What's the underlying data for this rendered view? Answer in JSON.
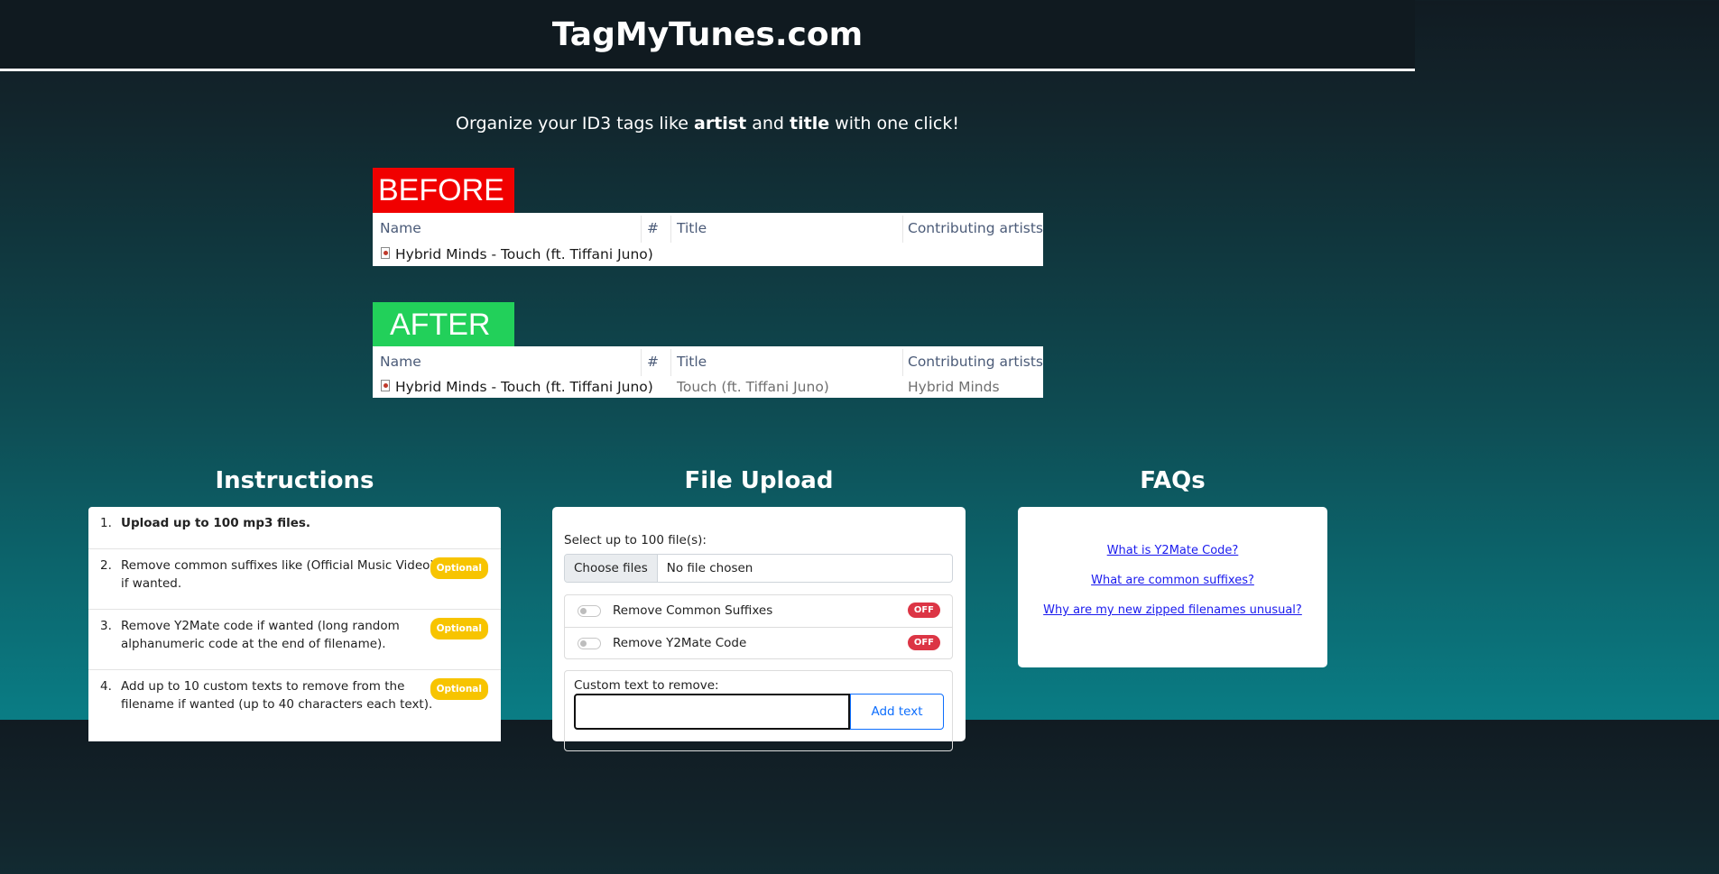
{
  "header": {
    "title": "TagMyTunes.com"
  },
  "tagline": {
    "before": "Organize your ID3 tags like ",
    "artist": "artist",
    "mid": " and ",
    "title": "title",
    "after": " with one click!"
  },
  "before": {
    "badge": "BEFORE",
    "columns": [
      "Name",
      "#",
      "Title",
      "Contributing artists"
    ],
    "row": {
      "name": "Hybrid Minds - Touch (ft. Tiffani Juno)",
      "number": "",
      "title": "",
      "artists": ""
    }
  },
  "after": {
    "badge": "AFTER",
    "columns": [
      "Name",
      "#",
      "Title",
      "Contributing artists"
    ],
    "row": {
      "name": "Hybrid Minds - Touch (ft. Tiffani Juno)",
      "number": "",
      "title": "Touch (ft. Tiffani Juno)",
      "artists": "Hybrid Minds"
    }
  },
  "instructions": {
    "heading": "Instructions",
    "items": [
      {
        "num": "1.",
        "text": "Upload up to 100 mp3 files.",
        "badge": ""
      },
      {
        "num": "2.",
        "text": "Remove common suffixes like (Official Music Video) if wanted.",
        "badge": "Optional"
      },
      {
        "num": "3.",
        "text": "Remove Y2Mate code if wanted (long random alphanumeric code at the end of filename).",
        "badge": "Optional"
      },
      {
        "num": "4.",
        "text": "Add up to 10 custom texts to remove from the filename if wanted (up to 40 characters each text).",
        "badge": "Optional"
      }
    ]
  },
  "upload": {
    "heading": "File Upload",
    "select_label": "Select up to 100 file(s):",
    "choose_button": "Choose files",
    "no_file": "No file chosen",
    "switches": [
      {
        "label": "Remove Common Suffixes",
        "state": "OFF"
      },
      {
        "label": "Remove Y2Mate Code",
        "state": "OFF"
      }
    ],
    "custom_label": "Custom text to remove:",
    "custom_value": "",
    "add_button": "Add text"
  },
  "faq": {
    "heading": "FAQs",
    "links": [
      "What is Y2Mate Code?",
      "What are common suffixes?",
      "Why are my new zipped filenames unusual?"
    ]
  },
  "colors": {
    "before_badge": "#f10000",
    "after_badge": "#22d05a",
    "optional_badge": "#f7c400",
    "off_badge": "#dc3545",
    "link": "#1a1aee"
  }
}
